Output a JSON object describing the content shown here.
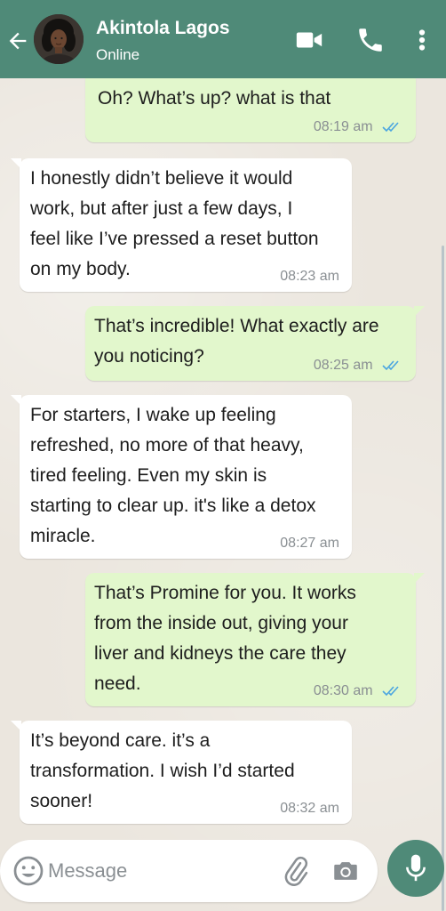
{
  "header": {
    "contact_name": "Akintola Lagos",
    "status": "Online",
    "color": "#4f8a78"
  },
  "icons": {
    "back": "arrow-left-icon",
    "video": "video-camera-icon",
    "call": "phone-icon",
    "menu": "vertical-dots-icon",
    "emoji": "emoji-icon",
    "attach": "paperclip-icon",
    "camera": "camera-icon",
    "mic": "microphone-icon"
  },
  "colors": {
    "outgoing_bubble": "#e2f7cc",
    "incoming_bubble": "#ffffff",
    "read_ticks": "#4aa5e0",
    "chat_background": "#ebe6de"
  },
  "messages": [
    {
      "direction": "out",
      "text": "Oh? What’s up? what is that",
      "time": "08:19 am",
      "read": true
    },
    {
      "direction": "in",
      "text": "I honestly didn’t believe it would\nwork, but after just a few days, I\nfeel like I’ve pressed a reset button\non my body.",
      "time": "08:23 am"
    },
    {
      "direction": "out",
      "text": "That’s incredible! What exactly are\nyou noticing?",
      "time": "08:25 am",
      "read": true
    },
    {
      "direction": "in",
      "text": "For starters, I wake up feeling\nrefreshed, no more of that heavy,\ntired feeling. Even my skin is\nstarting to clear up. it's like a detox\nmiracle.",
      "time": "08:27 am"
    },
    {
      "direction": "out",
      "text": "That’s Promine for you. It works\nfrom the inside out, giving your\nliver and kidneys the care they\nneed.",
      "time": "08:30 am",
      "read": true
    },
    {
      "direction": "in",
      "text": "It’s beyond care. it’s a\ntransformation. I wish I’d started\nsooner!",
      "time": "08:32 am"
    }
  ],
  "composer": {
    "placeholder": "Message",
    "value": ""
  }
}
